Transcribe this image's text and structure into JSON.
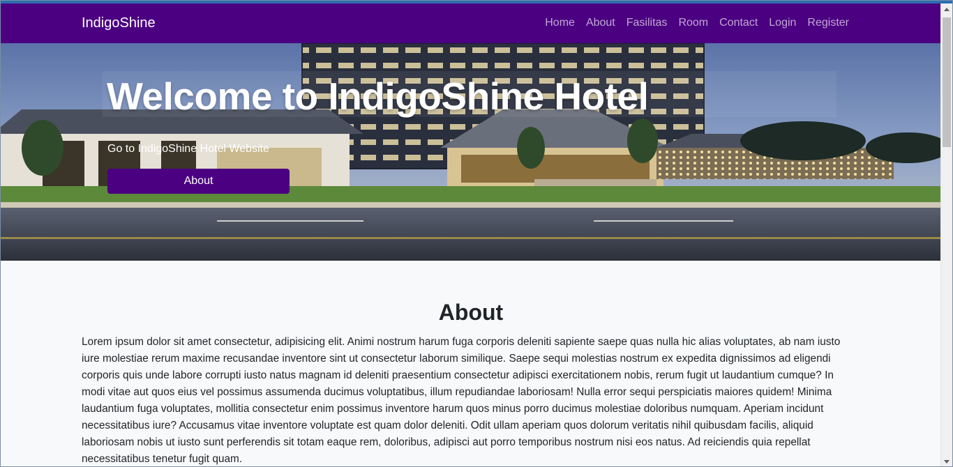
{
  "navbar": {
    "brand": "IndigoShine",
    "links": [
      "Home",
      "About",
      "Fasilitas",
      "Room",
      "Contact",
      "Login",
      "Register"
    ]
  },
  "hero": {
    "title": "Welcome to IndigoShine Hotel",
    "subtitle": "Go to IndigoShine Hotel Website",
    "button_label": "About"
  },
  "about": {
    "title": "About",
    "text": "Lorem ipsum dolor sit amet consectetur, adipisicing elit. Animi nostrum harum fuga corporis deleniti sapiente saepe quas nulla hic alias voluptates, ab nam iusto iure molestiae rerum maxime recusandae inventore sint ut consectetur laborum similique. Saepe sequi molestias nostrum ex expedita dignissimos ad eligendi corporis quis unde labore corrupti iusto natus magnam id deleniti praesentium consectetur adipisci exercitationem nobis, rerum fugit ut laudantium cumque? In modi vitae aut quos eius vel possimus assumenda ducimus voluptatibus, illum repudiandae laboriosam! Nulla error sequi perspiciatis maiores quidem! Minima laudantium fuga voluptates, mollitia consectetur enim possimus inventore harum quos minus porro ducimus molestiae doloribus numquam. Aperiam incidunt necessitatibus iure? Accusamus vitae inventore voluptate est quam dolor deleniti. Odit ullam aperiam quos dolorum veritatis nihil quibusdam facilis, aliquid laboriosam nobis ut iusto sunt perferendis sit totam eaque rem, doloribus, adipisci aut porro temporibus nostrum nisi eos natus. Ad reiciendis quia repellat necessitatibus tenetur fugit quam."
  },
  "colors": {
    "navbar_bg": "#4b0082",
    "button_bg": "#4b0082",
    "page_bg": "#f8f9fa"
  }
}
